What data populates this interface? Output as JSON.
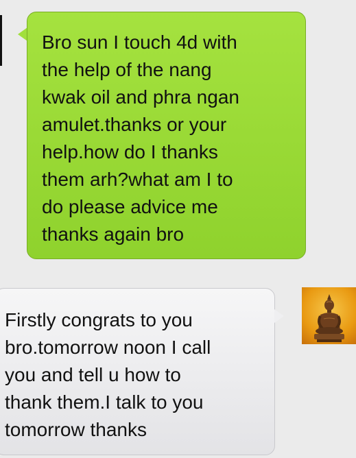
{
  "conversation": {
    "messages": [
      {
        "sender": "other",
        "text": "Bro sun I touch 4d with\nthe help of the nang\nkwak oil and phra ngan\namulet.thanks or your\nhelp.how do I thanks\nthem arh?what am I to\ndo please advice me\nthanks again bro",
        "bubble_color": "#9ad934"
      },
      {
        "sender": "me",
        "text": "Firstly congrats to you\nbro.tomorrow noon I call\nyou and tell u how to\nthank them.I talk to you\ntomorrow thanks",
        "bubble_color": "#ededef"
      }
    ],
    "avatar_icon": "buddha-statue-avatar"
  }
}
